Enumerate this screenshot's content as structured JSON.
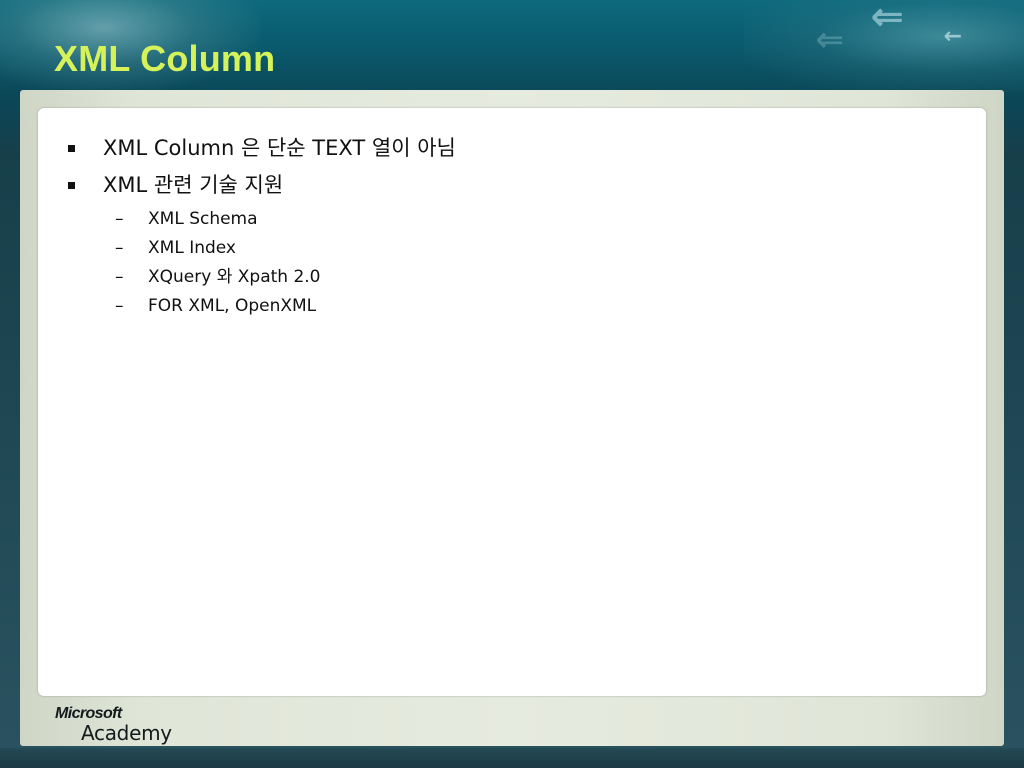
{
  "slide": {
    "title": "XML Column",
    "bullets": [
      {
        "text": "XML Column 은 단순 TEXT 열이 아님",
        "level": 1
      },
      {
        "text": "XML 관련 기술 지원",
        "level": 1
      },
      {
        "text": "XML Schema",
        "level": 2
      },
      {
        "text": "XML Index",
        "level": 2
      },
      {
        "text": "XQuery 와 Xpath 2.0",
        "level": 2
      },
      {
        "text": "FOR XML, OpenXML",
        "level": 2
      }
    ],
    "sub_bullet_glyph": "–",
    "logo": {
      "brand": "Microsoft",
      "product": "Academy"
    }
  },
  "colors": {
    "title": "#d6f25a",
    "header_teal": "#0d6a7c",
    "panel": "#ffffff",
    "frame": "#dfe5d7",
    "text": "#111111"
  },
  "icons": [
    "arrow-left-icon",
    "square-bullet-icon",
    "dash-bullet-icon"
  ]
}
